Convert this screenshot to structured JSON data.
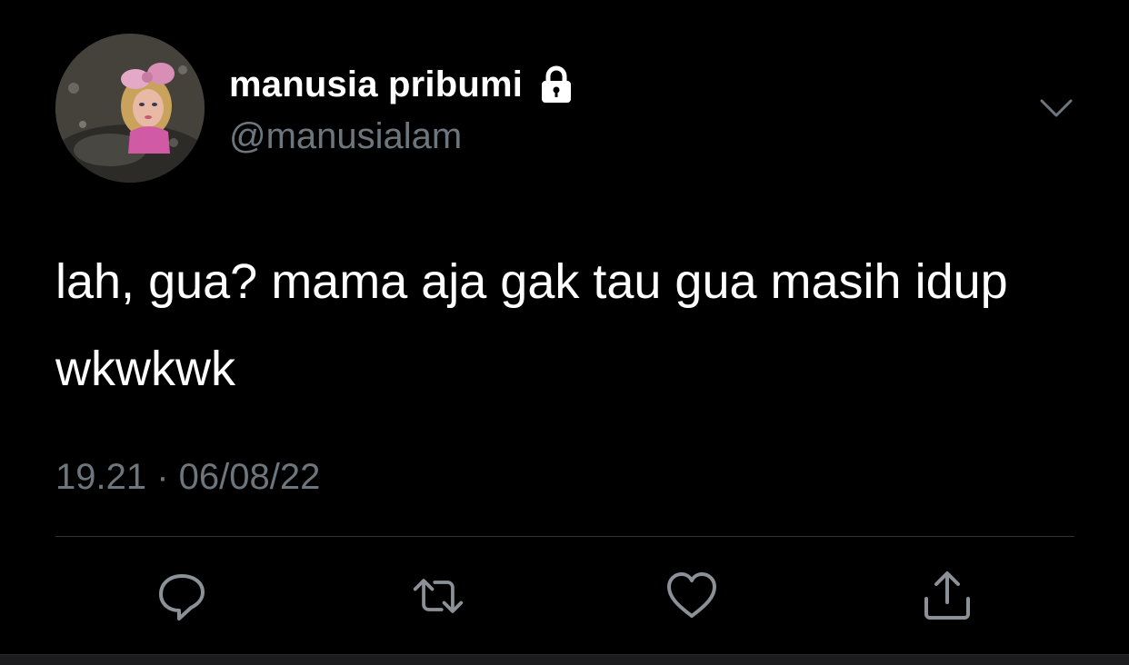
{
  "tweet": {
    "display_name": "manusia pribumi",
    "handle": "@manusialam",
    "text": "lah, gua? mama aja gak tau gua masih idup wkwkwk",
    "timestamp": "19.21 · 06/08/22",
    "is_protected": true
  },
  "icons": {
    "lock": "lock-icon",
    "caret": "chevron-down-icon",
    "reply": "reply-icon",
    "retweet": "retweet-icon",
    "like": "heart-icon",
    "share": "share-icon"
  },
  "colors": {
    "background": "#000000",
    "primary_text": "#ffffff",
    "secondary_text": "#6e767d",
    "divider": "#2f3336",
    "icon": "#8b9197"
  }
}
